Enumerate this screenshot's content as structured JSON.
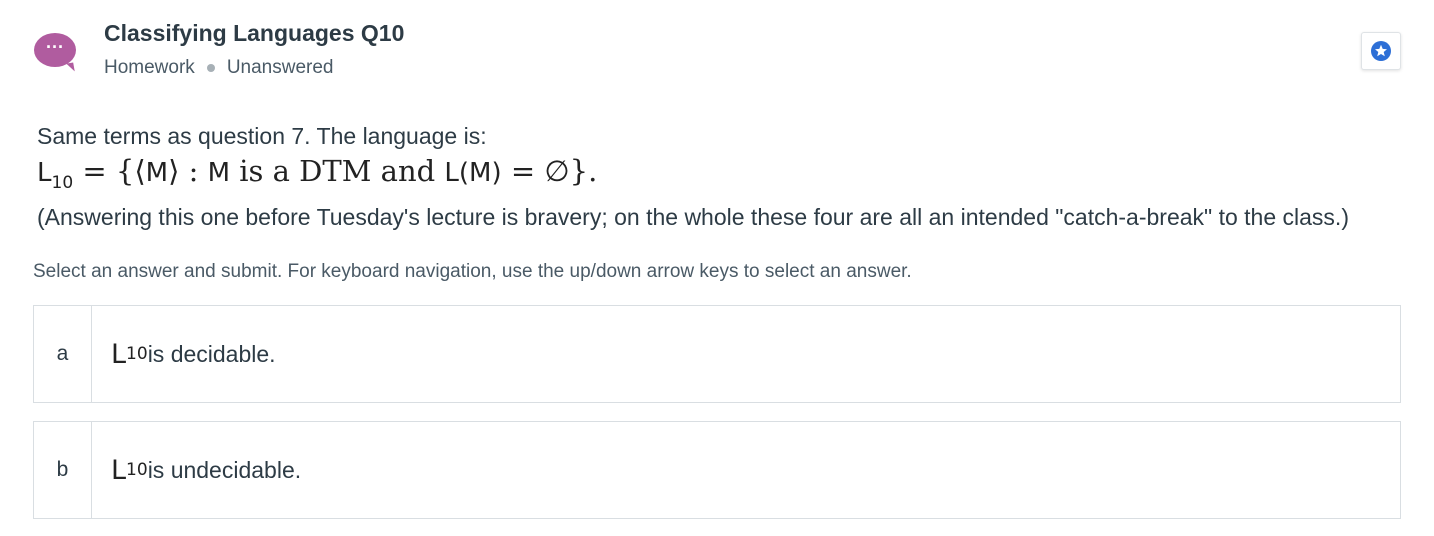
{
  "header": {
    "avatar_icon": "chat-bubble-ellipsis-icon",
    "title": "Classifying Languages Q10",
    "category": "Homework",
    "status": "Unanswered",
    "favorite_icon": "star-badge-icon",
    "accent_color": "#b05c9f",
    "star_color": "#2d6fd6"
  },
  "question": {
    "intro": "Same terms as question 7. The language is:",
    "math": {
      "lhs": "L",
      "lhs_sub": "10",
      "eq1": " = {⟨",
      "m1": "M",
      "mid1": "⟩ : ",
      "m2": "M",
      "mid2": " is a DTM and ",
      "lm": "L(M)",
      "rhs": " = ∅}."
    },
    "note": "(Answering this one before Tuesday's lecture is bravery; on the whole these four are all an intended \"catch-a-break\" to the class.)"
  },
  "instructions": "Select an answer and submit. For keyboard navigation, use the up/down arrow keys to select an answer.",
  "answers": [
    {
      "letter": "a",
      "L": "L",
      "sub": "10",
      "text": " is decidable."
    },
    {
      "letter": "b",
      "L": "L",
      "sub": "10",
      "text": " is undecidable."
    }
  ]
}
